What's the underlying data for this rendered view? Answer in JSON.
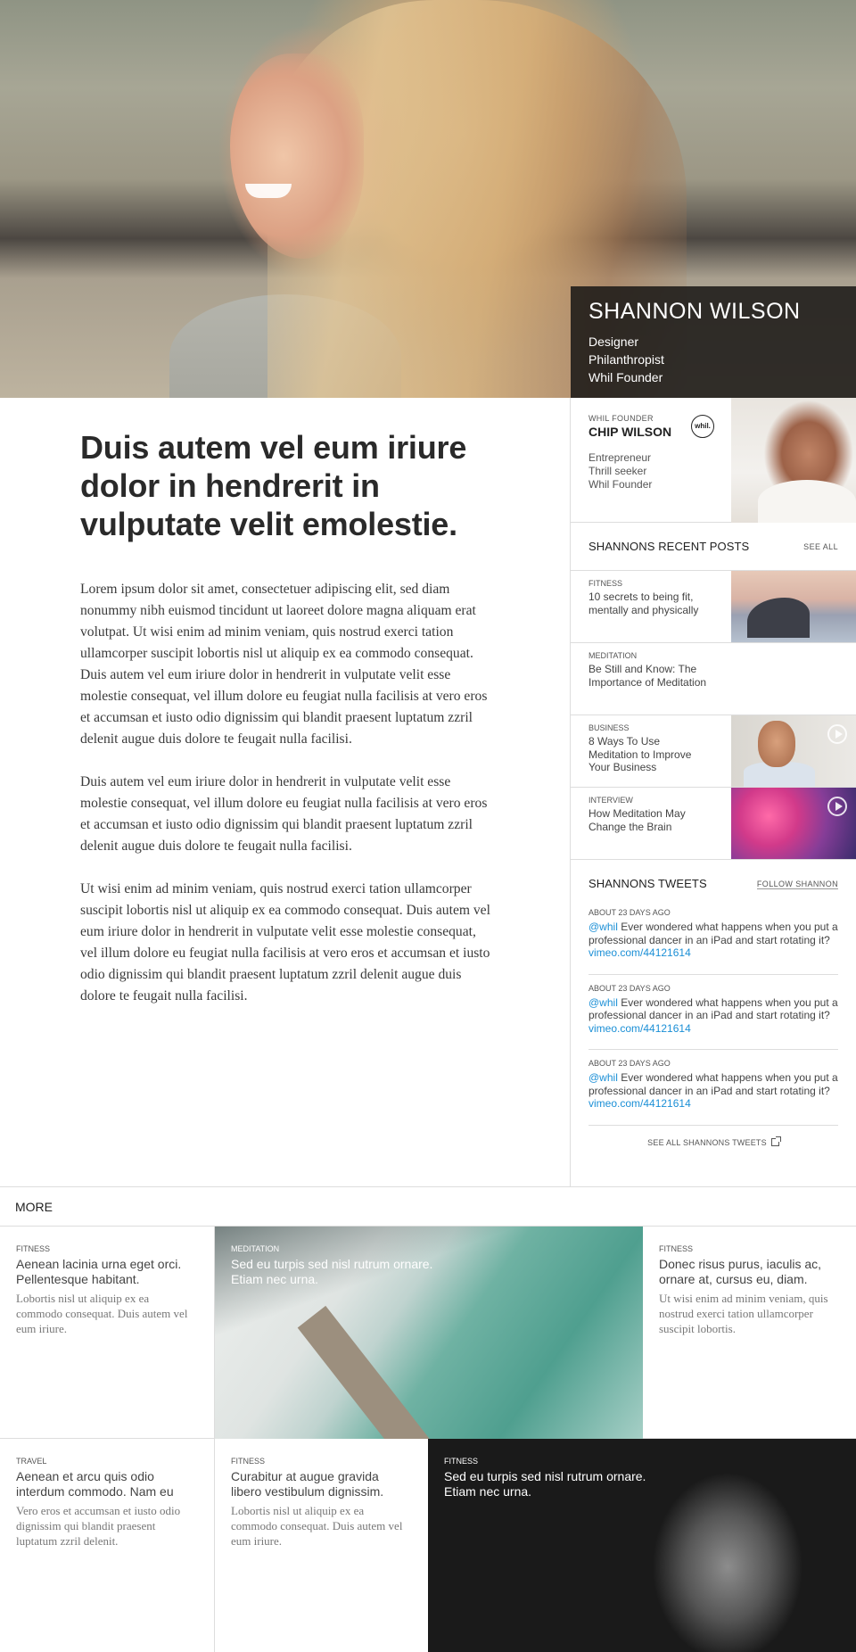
{
  "profile": {
    "name": "SHANNON WILSON",
    "roles": [
      "Designer",
      "Philanthropist",
      "Whil Founder"
    ]
  },
  "article": {
    "headline": "Duis autem vel eum iriure dolor in hendrerit in vulputate velit emolestie.",
    "paragraphs": [
      "Lorem ipsum dolor sit amet, consectetuer adipiscing elit, sed diam nonummy nibh euismod tincidunt ut laoreet dolore magna aliquam erat volutpat. Ut wisi enim ad minim veniam, quis nostrud exerci tation ullamcorper suscipit lobortis nisl ut aliquip ex ea commodo consequat. Duis autem vel eum iriure dolor in hendrerit in vulputate velit esse molestie consequat, vel illum dolore eu feugiat nulla facilisis at vero eros et accumsan et iusto odio dignissim qui blandit praesent luptatum zzril delenit augue duis dolore te feugait nulla facilisi.",
      "Duis autem vel eum iriure dolor in hendrerit in vulputate velit esse molestie consequat, vel illum dolore eu feugiat nulla facilisis at vero eros et accumsan et iusto odio dignissim qui blandit praesent luptatum zzril delenit augue duis dolore te feugait nulla facilisi.",
      "Ut wisi enim ad minim veniam, quis nostrud exerci tation ullamcorper suscipit lobortis nisl ut aliquip ex ea commodo consequat. Duis autem vel eum iriure dolor in hendrerit in vulputate velit esse molestie consequat, vel illum dolore eu feugiat nulla facilisis at vero eros et accumsan et iusto odio dignissim qui blandit praesent luptatum zzril delenit augue duis dolore te feugait nulla facilisi."
    ]
  },
  "founder": {
    "label": "WHIL FOUNDER",
    "name": "CHIP WILSON",
    "traits": [
      "Entrepreneur",
      "Thrill seeker",
      "Whil Founder"
    ],
    "logo": "whil."
  },
  "posts": {
    "title": "SHANNONS RECENT POSTS",
    "see_all": "SEE ALL",
    "items": [
      {
        "category": "FITNESS",
        "title": "10 secrets to being fit, mentally and physically"
      },
      {
        "category": "MEDITATION",
        "title": "Be Still and Know: The Importance of Meditation"
      },
      {
        "category": "BUSINESS",
        "title": "8 Ways To Use Meditation to Improve Your Business"
      },
      {
        "category": "INTERVIEW",
        "title": "How Meditation May Change the Brain"
      }
    ]
  },
  "tweets": {
    "title": "SHANNONS TWEETS",
    "follow": "FOLLOW SHANNON",
    "items": [
      {
        "time": "ABOUT 23 DAYS AGO",
        "handle": "@whil",
        "text": " Ever wondered what happens when you put a professional dancer in an iPad and start rotating it? ",
        "link": "vimeo.com/44121614"
      },
      {
        "time": "ABOUT 23 DAYS AGO",
        "handle": "@whil",
        "text": " Ever wondered what happens when you put a professional dancer in an iPad and start rotating it? ",
        "link": "vimeo.com/44121614"
      },
      {
        "time": "ABOUT 23 DAYS AGO",
        "handle": "@whil",
        "text": " Ever wondered what happens when you put a professional dancer in an iPad and start rotating it? ",
        "link": "vimeo.com/44121614"
      }
    ],
    "see_all": "SEE ALL SHANNONS TWEETS"
  },
  "more": {
    "title": "MORE",
    "tiles": [
      {
        "category": "FITNESS",
        "title": "Aenean lacinia urna eget orci. Pellentesque habitant.",
        "body": "Lobortis nisl ut aliquip ex ea commodo consequat. Duis autem vel eum iriure."
      },
      {
        "category": "MEDITATION",
        "title": "Sed eu turpis sed nisl rutrum ornare. Etiam nec urna."
      },
      {
        "category": "FITNESS",
        "title": "Donec risus purus, iaculis ac, ornare at, cursus eu, diam.",
        "body": "Ut wisi enim ad minim veniam, quis nostrud exerci tation ullamcorper suscipit lobortis."
      },
      {
        "category": "TRAVEL",
        "title": "Aenean et arcu quis odio interdum commodo. Nam eu",
        "body": "Vero eros et accumsan et iusto odio dignissim qui blandit praesent luptatum zzril delenit."
      },
      {
        "category": "FITNESS",
        "title": "Curabitur at augue gravida libero vestibulum dignissim.",
        "body": "Lobortis nisl ut aliquip ex ea commodo consequat. Duis autem vel eum iriure."
      },
      {
        "category": "FITNESS",
        "title": "Sed eu turpis sed nisl rutrum ornare. Etiam nec urna."
      }
    ]
  },
  "colors": {
    "link": "#1b8fd6",
    "profile_box": "#1c1a18"
  }
}
